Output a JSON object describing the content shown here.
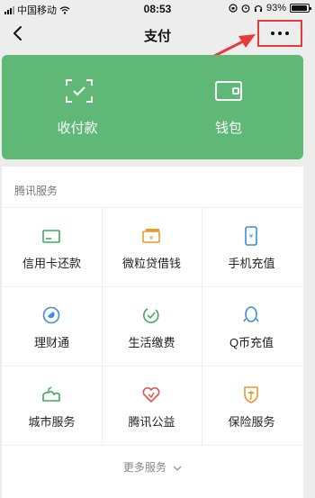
{
  "status_bar": {
    "carrier": "中国移动",
    "time": "08:53",
    "battery": "93%",
    "battery_level": 0.93
  },
  "nav": {
    "title": "支付",
    "back_icon": "chevron-left-icon",
    "more_icon": "more-dots-icon"
  },
  "annotation": {
    "highlight_color": "#e53a3a"
  },
  "wallet_card": {
    "color": "#5fb876",
    "items": [
      {
        "label": "收付款",
        "icon": "scan-frame-icon"
      },
      {
        "label": "钱包",
        "icon": "wallet-icon"
      }
    ]
  },
  "services": {
    "title": "腾讯服务",
    "items": [
      {
        "label": "信用卡还款",
        "icon": "credit-card-icon"
      },
      {
        "label": "微粒贷借钱",
        "icon": "loan-cash-icon"
      },
      {
        "label": "手机充值",
        "icon": "phone-recharge-icon"
      },
      {
        "label": "理财通",
        "icon": "wealth-icon"
      },
      {
        "label": "生活缴费",
        "icon": "utility-payment-icon"
      },
      {
        "label": "Q币充值",
        "icon": "qq-penguin-icon"
      },
      {
        "label": "城市服务",
        "icon": "city-service-icon"
      },
      {
        "label": "腾讯公益",
        "icon": "charity-heart-icon"
      },
      {
        "label": "保险服务",
        "icon": "insurance-umbrella-icon"
      }
    ],
    "more_label": "更多服务"
  }
}
